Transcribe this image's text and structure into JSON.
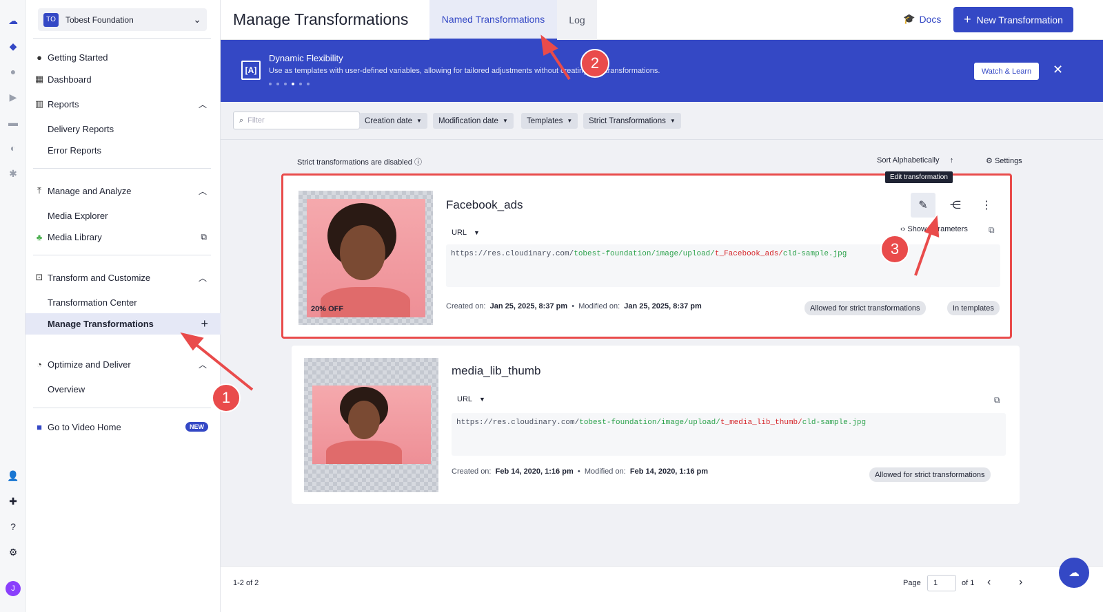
{
  "sidebar": {
    "org_badge": "TO",
    "org_name": "Tobest Foundation",
    "items": {
      "getting_started": "Getting Started",
      "dashboard": "Dashboard",
      "reports": "Reports",
      "delivery_reports": "Delivery Reports",
      "error_reports": "Error Reports",
      "manage_analyze": "Manage and Analyze",
      "media_explorer": "Media Explorer",
      "media_library": "Media Library",
      "transform_customize": "Transform and Customize",
      "transformation_center": "Transformation Center",
      "manage_transformations": "Manage Transformations",
      "optimize_deliver": "Optimize and Deliver",
      "overview": "Overview",
      "video_home": "Go to Video Home",
      "new_badge": "NEW"
    },
    "avatar_letter": "J"
  },
  "header": {
    "title": "Manage Transformations",
    "tabs": [
      "Named Transformations",
      "Log"
    ],
    "docs": "Docs",
    "new_button": "New Transformation"
  },
  "banner": {
    "title": "Dynamic Flexibility",
    "text": "Use as templates with user-defined variables, allowing for tailored adjustments without creating new transformations.",
    "watch": "Watch & Learn",
    "active_dot": 4,
    "dot_count": 6
  },
  "filters": {
    "placeholder": "Filter",
    "chips": [
      "Creation date",
      "Modification date",
      "Templates",
      "Strict Transformations"
    ]
  },
  "list": {
    "strict_note": "Strict transformations are disabled",
    "sort": "Sort Alphabetically",
    "settings": "Settings",
    "tooltip": "Edit transformation",
    "show_params": "Show Parameters"
  },
  "cards": [
    {
      "name": "Facebook_ads",
      "url_type": "URL",
      "url_prefix": "https://res.cloudinary.com/",
      "url_cloud": "tobest-foundation/image/upload/",
      "url_transform": "t_Facebook_ads/",
      "url_file": "cld-sample.jpg",
      "created_label": "Created on:",
      "created": "Jan 25, 2025, 8:37 pm",
      "modified_label": "Modified on:",
      "modified": "Jan 25, 2025, 8:37 pm",
      "tags": [
        "Allowed for strict transformations",
        "In templates"
      ],
      "promo": "20% OFF"
    },
    {
      "name": "media_lib_thumb",
      "url_type": "URL",
      "url_prefix": "https://res.cloudinary.com/",
      "url_cloud": "tobest-foundation/image/upload/",
      "url_transform": "t_media_lib_thumb/",
      "url_file": "cld-sample.jpg",
      "created_label": "Created on:",
      "created": "Feb 14, 2020, 1:16 pm",
      "modified_label": "Modified on:",
      "modified": "Feb 14, 2020, 1:16 pm",
      "tags": [
        "Allowed for strict transformations"
      ]
    }
  ],
  "footer": {
    "count": "1-2 of 2",
    "page_label": "Page",
    "page_value": "1",
    "of": "of 1"
  },
  "annotations": [
    "1",
    "2",
    "3"
  ],
  "colors": {
    "accent": "#3448c5",
    "highlight": "#e94b4b",
    "url_green": "#2ca24c",
    "url_red": "#d5262b"
  }
}
